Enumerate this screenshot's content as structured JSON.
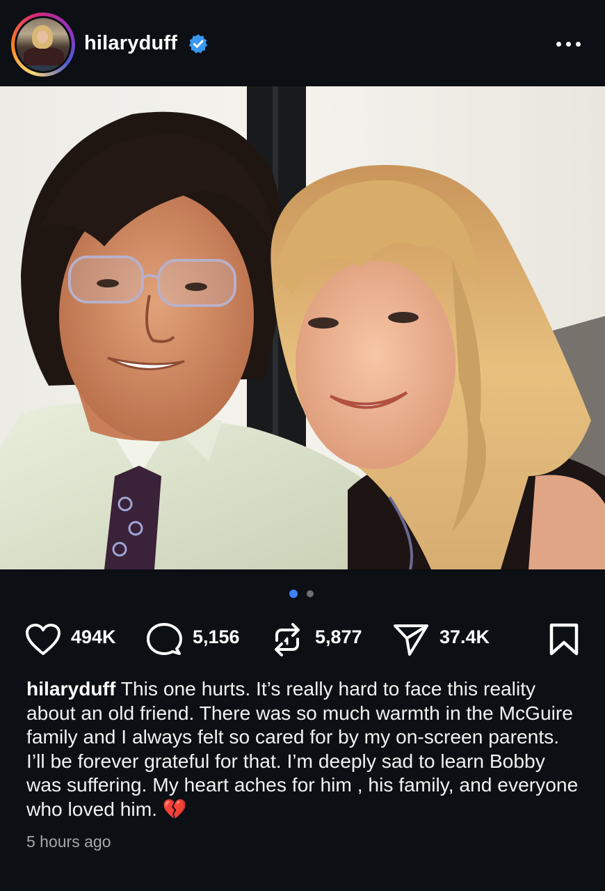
{
  "post": {
    "username": "hilaryduff",
    "verified": true,
    "more_icon": "more-horizontal-icon",
    "carousel": {
      "total": 2,
      "active_index": 0
    },
    "stats": {
      "likes": "494K",
      "comments": "5,156",
      "reposts": "5,877",
      "shares": "37.4K"
    },
    "caption": {
      "username": "hilaryduff",
      "text": "This one hurts. It’s really hard to face this reality about an old friend. There was so much warmth in the McGuire family and I always felt so cared for by my on-screen parents. I’ll be forever grateful for that. I’m deeply sad to learn Bobby was suffering. My heart aches for him , his family, and everyone who loved him. 💔"
    },
    "timestamp": "5 hours ago"
  },
  "colors": {
    "background": "#0c0f14",
    "verified_blue": "#3897f0",
    "carousel_active": "#3d82f6",
    "carousel_inactive": "#6b6f76",
    "broken_heart": "#e0245e"
  }
}
